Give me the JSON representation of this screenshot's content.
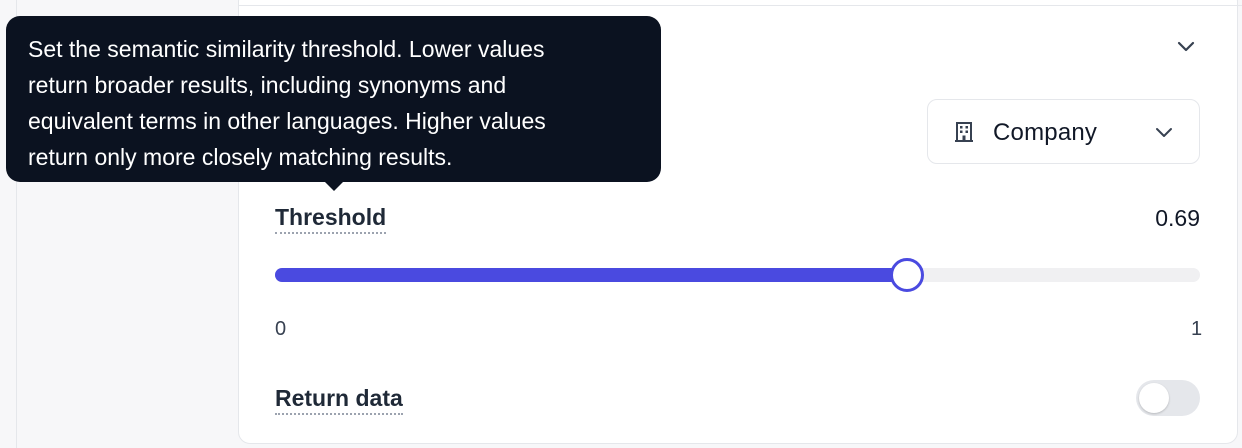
{
  "tooltip": {
    "lines": [
      "Set the semantic similarity threshold. Lower values",
      "return broader results, including synonyms and",
      "equivalent terms in other languages. Higher values",
      "return only more closely matching results."
    ]
  },
  "entity_select": {
    "icon": "building-icon",
    "selected": "Company"
  },
  "threshold": {
    "label": "Threshold",
    "value": "0.69",
    "fraction": 0.69,
    "min_label": "0",
    "max_label": "1"
  },
  "return_data": {
    "label": "Return data",
    "enabled": false
  },
  "colors": {
    "accent": "#4a4ae0",
    "tooltip_bg": "#0b1220",
    "track": "#f0f0f2"
  }
}
